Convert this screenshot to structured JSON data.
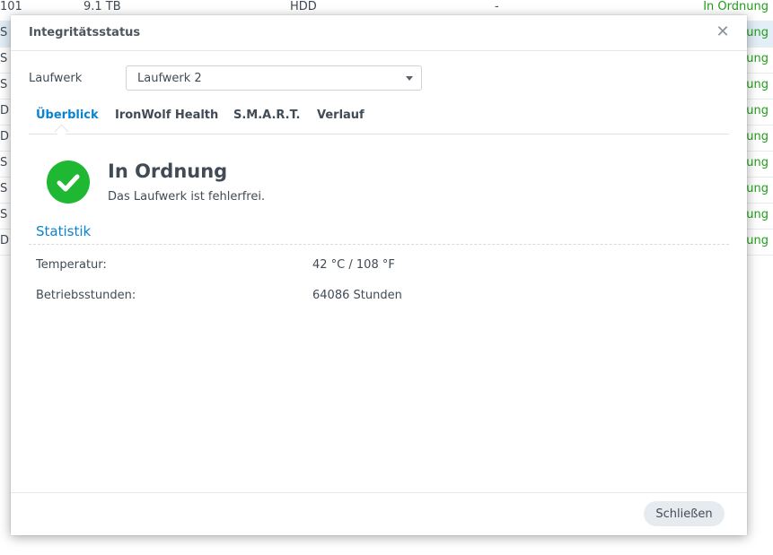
{
  "background_table": {
    "first_row": {
      "id": "101",
      "size": "9.1 TB",
      "type": "HDD",
      "dash": "-",
      "status": "In Ordnung"
    },
    "rows": [
      {
        "letter": "S",
        "status": "In Ordnung"
      },
      {
        "letter": "S",
        "status": "In Ordnung"
      },
      {
        "letter": "S",
        "status": "In Ordnung"
      },
      {
        "letter": "D",
        "status": "In Ordnung"
      },
      {
        "letter": "D",
        "status": "In Ordnung"
      },
      {
        "letter": "S",
        "status": "In Ordnung"
      },
      {
        "letter": "S",
        "status": "In Ordnung"
      },
      {
        "letter": "S",
        "status": "In Ordnung"
      },
      {
        "letter": "D",
        "status": "In Ordnung"
      }
    ]
  },
  "dialog": {
    "title": "Integritätsstatus",
    "drive_label": "Laufwerk",
    "drive_selected": "Laufwerk 2",
    "tabs": [
      "Überblick",
      "IronWolf Health",
      "S.M.A.R.T.",
      "Verlauf"
    ],
    "active_tab": "Überblick",
    "status": {
      "title": "In Ordnung",
      "description": "Das Laufwerk ist fehlerfrei."
    },
    "section_title": "Statistik",
    "stats": [
      {
        "label": "Temperatur:",
        "value": "42 °C / 108 °F"
      },
      {
        "label": "Betriebsstunden:",
        "value": "64086 Stunden"
      }
    ],
    "close_button": "Schließen"
  },
  "colors": {
    "accent": "#0a83d0",
    "ok_green": "#1eb832",
    "status_text_green": "#20a019"
  }
}
